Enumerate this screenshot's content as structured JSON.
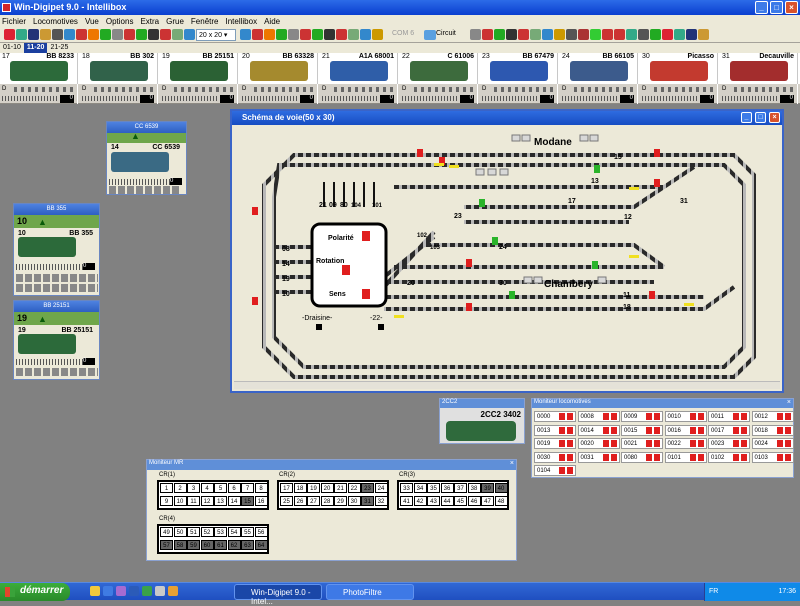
{
  "app": {
    "title": "Win-Digipet 9.0 - Intellibox"
  },
  "menu": [
    "Fichier",
    "Locomotives",
    "Vue",
    "Options",
    "Extra",
    "Grue",
    "Fenêtre",
    "Intellibox",
    "Aide"
  ],
  "toolbar": {
    "zoom": "20 x 20",
    "com": "COM 6",
    "circuit": "Circuit"
  },
  "range_tabs": [
    "01-10",
    "11-20",
    "21-25"
  ],
  "active_range": "11-20",
  "strip_locos": [
    {
      "num": "17",
      "name": "BB 8233",
      "color": "#2c6a3a"
    },
    {
      "num": "18",
      "name": "BB 302",
      "color": "#31624a"
    },
    {
      "num": "19",
      "name": "BB 25151",
      "color": "#2b6134"
    },
    {
      "num": "20",
      "name": "BB 63328",
      "color": "#a58a2e"
    },
    {
      "num": "21",
      "name": "A1A 68001",
      "color": "#2f5ea8"
    },
    {
      "num": "22",
      "name": "C 61006",
      "color": "#3d6b3d"
    },
    {
      "num": "23",
      "name": "BB 67479",
      "color": "#2d58b0"
    },
    {
      "num": "24",
      "name": "BB 66105",
      "color": "#3c5b8c"
    },
    {
      "num": "30",
      "name": "Picasso",
      "color": "#c33a2f"
    },
    {
      "num": "31",
      "name": "Decauville",
      "color": "#a32d2d"
    }
  ],
  "strip_speed": [
    "0",
    "0",
    "0",
    "0",
    "0",
    "0",
    "0",
    "0",
    "0",
    "0"
  ],
  "loco_windows": [
    {
      "title": "CC 6539",
      "num": "14",
      "name": "CC 6539",
      "speed": "0"
    },
    {
      "title": "BB 355",
      "num": "10",
      "name": "BB 355",
      "step": "10",
      "speed": "0"
    },
    {
      "title": "BB 25151",
      "num": "19",
      "name": "BB 25151",
      "step": "19",
      "speed": "0"
    }
  ],
  "scheme": {
    "title": "Schéma de voie(50 x 30)",
    "station_modane": "Modane",
    "station_chambery": "Chambery",
    "panel_polarite": "Polarité",
    "panel_rotation": "Rotation",
    "panel_sens": "Sens",
    "draisine": "-Draisine-",
    "label_22": "-22-",
    "track_numbers": [
      "15",
      "13",
      "17",
      "12",
      "31",
      "23",
      "24",
      "20",
      "30",
      "11",
      "18",
      "08",
      "14",
      "19",
      "10",
      "21",
      "09",
      "80",
      "104",
      "101",
      "102",
      "103"
    ]
  },
  "cc2": {
    "title": "2CC2",
    "name": "2CC2 3402"
  },
  "loco_monitor": {
    "title": "Moniteur locomotives",
    "cells": [
      "0000",
      "0008",
      "0009",
      "0010",
      "0011",
      "0012",
      "0013",
      "0014",
      "0015",
      "0016",
      "0017",
      "0018",
      "0019",
      "0020",
      "0021",
      "0022",
      "0023",
      "0024",
      "0030",
      "0031",
      "0080",
      "0101",
      "0102",
      "0103",
      "0104"
    ]
  },
  "mr_monitor": {
    "title": "Moniteur MR",
    "groups": [
      {
        "label": "CR(1)",
        "cells": [
          "1",
          "2",
          "3",
          "4",
          "5",
          "6",
          "7",
          "8",
          "9",
          "10",
          "11",
          "12",
          "13",
          "14",
          "15",
          "16"
        ],
        "dark": [
          "15"
        ]
      },
      {
        "label": "CR(2)",
        "cells": [
          "17",
          "18",
          "19",
          "20",
          "21",
          "22",
          "23",
          "24",
          "25",
          "26",
          "27",
          "28",
          "29",
          "30",
          "31",
          "32"
        ],
        "dark": [
          "23",
          "31"
        ]
      },
      {
        "label": "CR(3)",
        "cells": [
          "33",
          "34",
          "35",
          "36",
          "37",
          "38",
          "39",
          "40",
          "41",
          "42",
          "43",
          "44",
          "45",
          "46",
          "47",
          "48"
        ],
        "dark": [
          "39",
          "40"
        ]
      },
      {
        "label": "CR(4)",
        "cells": [
          "49",
          "50",
          "51",
          "52",
          "53",
          "54",
          "55",
          "56",
          "57",
          "58",
          "59",
          "60",
          "61",
          "62",
          "63",
          "64"
        ],
        "dark": [
          "57",
          "58",
          "59",
          "60",
          "61",
          "62",
          "63",
          "64"
        ]
      }
    ]
  },
  "taskbar": {
    "start": "démarrer",
    "tasks": [
      "Win-Digipet 9.0 - Intel...",
      "PhotoFiltre"
    ],
    "lang": "FR",
    "clock": "17:36"
  },
  "colors": {
    "title_blue": "#0a3fcf",
    "desktop": "#818181",
    "track": "#2a2a2a",
    "signal_red": "#e01e1e",
    "signal_green": "#2ab42a",
    "signal_yellow": "#f0e020"
  }
}
